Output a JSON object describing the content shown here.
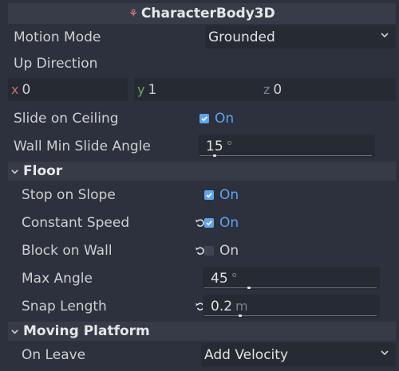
{
  "header": {
    "node_icon": "character-body-3d-icon",
    "title": "CharacterBody3D"
  },
  "motion_mode": {
    "label": "Motion Mode",
    "value": "Grounded"
  },
  "up_direction": {
    "label": "Up Direction",
    "x_axis": "x",
    "x": "0",
    "y_axis": "y",
    "y": "1",
    "z_axis": "z",
    "z": "0"
  },
  "slide_on_ceiling": {
    "label": "Slide on Ceiling",
    "value": "On",
    "checked": true
  },
  "wall_min_slide_angle": {
    "label": "Wall Min Slide Angle",
    "value": "15",
    "unit": "°"
  },
  "floor": {
    "title": "Floor",
    "stop_on_slope": {
      "label": "Stop on Slope",
      "value": "On",
      "checked": true
    },
    "constant_speed": {
      "label": "Constant Speed",
      "value": "On",
      "checked": true
    },
    "block_on_wall": {
      "label": "Block on Wall",
      "value": "On",
      "checked": false
    },
    "max_angle": {
      "label": "Max Angle",
      "value": "45",
      "unit": "°"
    },
    "snap_length": {
      "label": "Snap Length",
      "value": "0.2",
      "unit": "m"
    }
  },
  "moving_platform": {
    "title": "Moving Platform",
    "on_leave": {
      "label": "On Leave",
      "value": "Add Velocity"
    }
  },
  "colors": {
    "accent": "#5fa3ec",
    "background": "#2c313d",
    "field": "#262a33"
  }
}
